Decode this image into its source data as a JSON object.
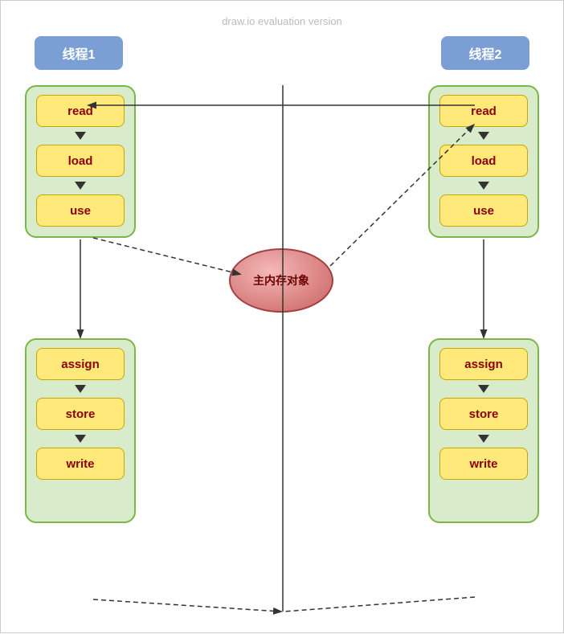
{
  "watermark": "draw.io evaluation version",
  "thread1": {
    "label": "线程1",
    "steps_top": [
      "read",
      "load",
      "use"
    ],
    "steps_bot": [
      "assign",
      "store",
      "write"
    ]
  },
  "thread2": {
    "label": "线程2",
    "steps_top": [
      "read",
      "load",
      "use"
    ],
    "steps_bot": [
      "assign",
      "store",
      "write"
    ]
  },
  "memory_object": "主内存对象"
}
